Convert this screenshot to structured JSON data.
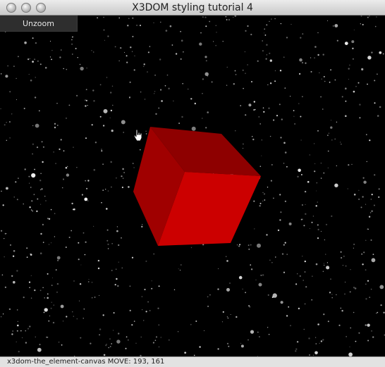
{
  "window": {
    "title": "X3DOM styling tutorial 4"
  },
  "toolbar": {
    "zoom_label": "Unzoom"
  },
  "scene": {
    "background_color": "#000000",
    "star_color": "#ffffff",
    "cube_colors": {
      "front": "#cc0000",
      "top": "#8e0000",
      "left": "#a00000"
    }
  },
  "status": {
    "text": "x3dom-the_element-canvas MOVE: 193, 161"
  }
}
